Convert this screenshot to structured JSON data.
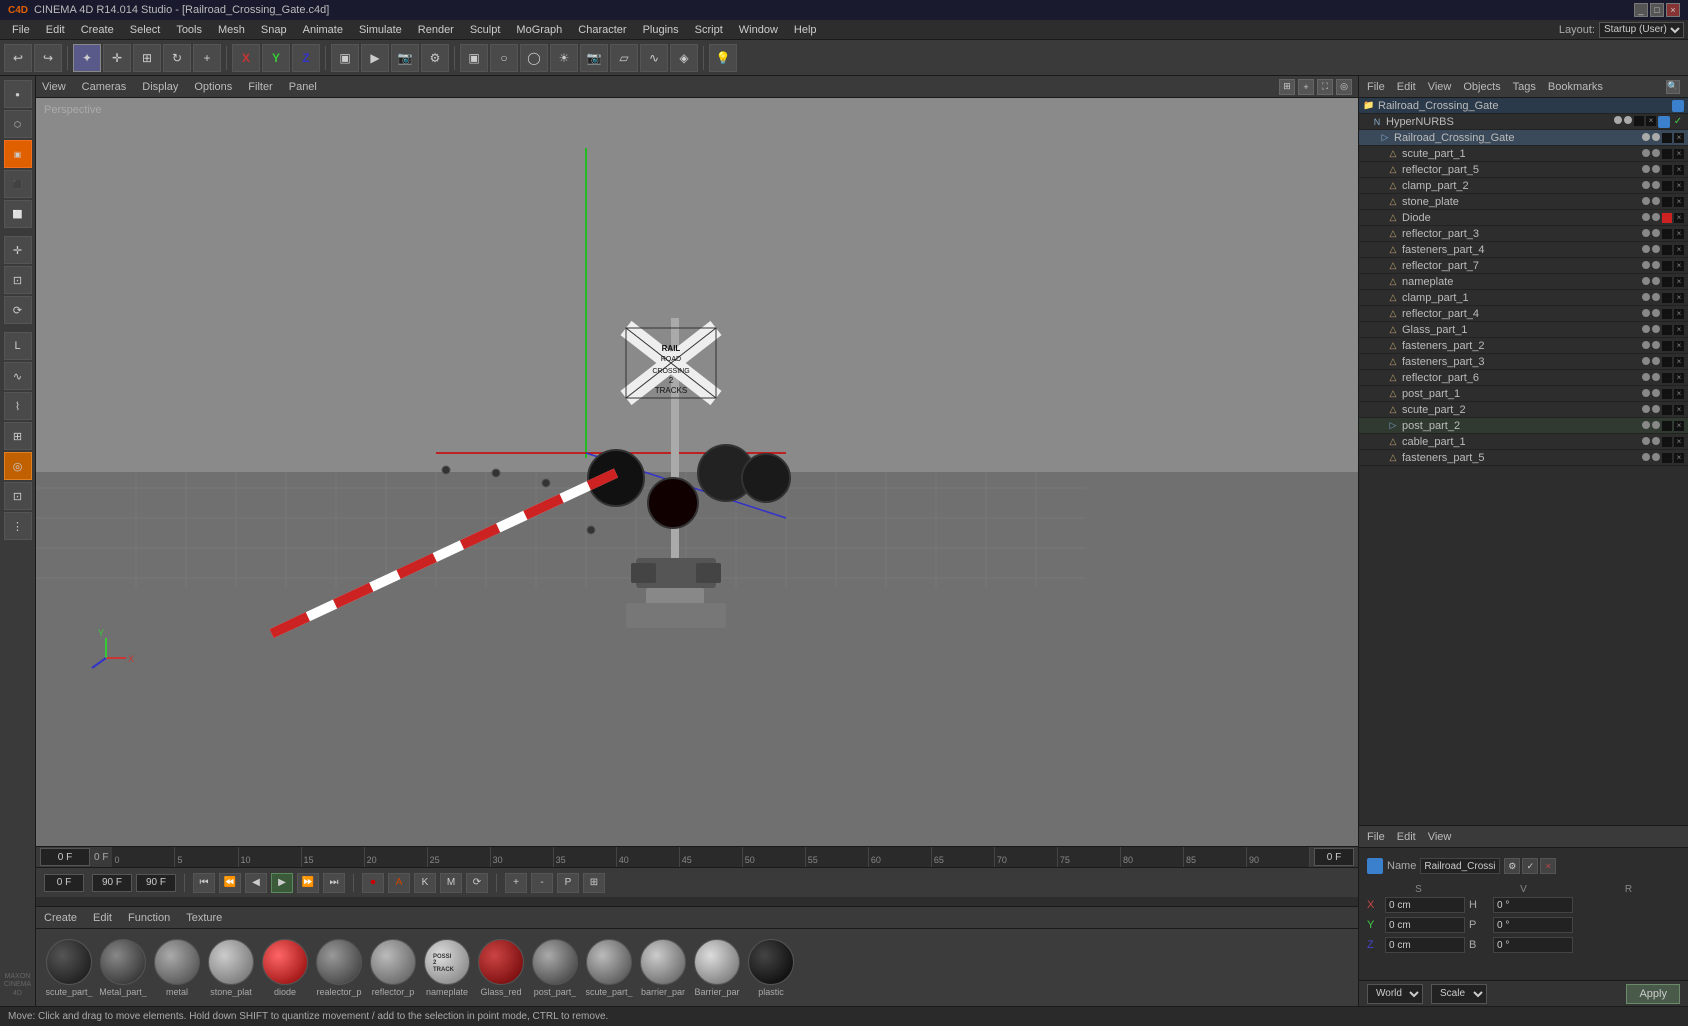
{
  "titleBar": {
    "title": "CINEMA 4D R14.014 Studio - [Railroad_Crossing_Gate.c4d]",
    "winControls": [
      "_",
      "□",
      "×"
    ]
  },
  "menuBar": {
    "items": [
      "File",
      "Edit",
      "Create",
      "Select",
      "Tools",
      "Mesh",
      "Snap",
      "Animate",
      "Simulate",
      "Render",
      "Sculpt",
      "MoGraph",
      "Character",
      "Plugins",
      "Script",
      "Window",
      "Help"
    ]
  },
  "layout": {
    "label": "Layout:",
    "value": "Startup (User)"
  },
  "viewport": {
    "label": "Perspective",
    "tabs": [
      "View",
      "Cameras",
      "Display",
      "Options",
      "Filter",
      "Panel"
    ]
  },
  "objectManager": {
    "tabs": [
      "File",
      "Edit",
      "View",
      "Objects",
      "Tags",
      "Bookmarks"
    ],
    "rootItem": "Railroad_Crossing_Gate",
    "items": [
      {
        "name": "HyperNURBS",
        "level": 1,
        "type": "nurbs",
        "icon": "N"
      },
      {
        "name": "Railroad_Crossing_Gate",
        "level": 2,
        "type": "folder"
      },
      {
        "name": "scute_part_1",
        "level": 3,
        "type": "mesh"
      },
      {
        "name": "reflector_part_5",
        "level": 3,
        "type": "mesh"
      },
      {
        "name": "clamp_part_2",
        "level": 3,
        "type": "mesh"
      },
      {
        "name": "stone_plate",
        "level": 3,
        "type": "mesh"
      },
      {
        "name": "Diode",
        "level": 3,
        "type": "mesh"
      },
      {
        "name": "reflector_part_3",
        "level": 3,
        "type": "mesh"
      },
      {
        "name": "fasteners_part_4",
        "level": 3,
        "type": "mesh"
      },
      {
        "name": "reflector_part_7",
        "level": 3,
        "type": "mesh"
      },
      {
        "name": "nameplate",
        "level": 3,
        "type": "mesh"
      },
      {
        "name": "clamp_part_1",
        "level": 3,
        "type": "mesh"
      },
      {
        "name": "reflector_part_4",
        "level": 3,
        "type": "mesh"
      },
      {
        "name": "Glass_part_1",
        "level": 3,
        "type": "mesh"
      },
      {
        "name": "fasteners_part_2",
        "level": 3,
        "type": "mesh"
      },
      {
        "name": "fasteners_part_3",
        "level": 3,
        "type": "mesh"
      },
      {
        "name": "reflector_part_6",
        "level": 3,
        "type": "mesh"
      },
      {
        "name": "post_part_1",
        "level": 3,
        "type": "mesh"
      },
      {
        "name": "scute_part_2",
        "level": 3,
        "type": "mesh"
      },
      {
        "name": "post_part_2",
        "level": 3,
        "type": "folder"
      },
      {
        "name": "cable_part_1",
        "level": 3,
        "type": "mesh"
      },
      {
        "name": "fasteners_part_5",
        "level": 3,
        "type": "mesh"
      }
    ]
  },
  "attributeManager": {
    "tabs": [
      "File",
      "Edit",
      "View"
    ],
    "nameLabel": "Name",
    "nameValue": "Railroad_Crossing_Gate",
    "coords": {
      "x": {
        "label": "X",
        "pos": "0 cm",
        "size": "H",
        "sizeVal": "0°"
      },
      "y": {
        "label": "Y",
        "pos": "0 cm",
        "size": "P",
        "sizeVal": "0°"
      },
      "z": {
        "label": "Z",
        "pos": "0 cm",
        "size": "B",
        "sizeVal": "0°"
      }
    },
    "coordMode": "World",
    "transformMode": "Scale",
    "applyLabel": "Apply"
  },
  "timeline": {
    "currentFrame": "0 F",
    "startFrame": "0 F",
    "startInput": "0 F",
    "endFrame": "90 F",
    "endInput": "90 F",
    "marks": [
      "0",
      "5",
      "10",
      "15",
      "20",
      "25",
      "30",
      "35",
      "40",
      "45",
      "50",
      "55",
      "60",
      "65",
      "70",
      "75",
      "80",
      "85",
      "90"
    ]
  },
  "materialArea": {
    "tabs": [
      "Create",
      "Edit",
      "Function",
      "Texture"
    ],
    "materials": [
      {
        "label": "scute_part_",
        "color": "#111",
        "gradient": "radial-gradient(circle at 35% 35%, #555, #111)"
      },
      {
        "label": "Metal_part_",
        "color": "#333",
        "gradient": "radial-gradient(circle at 35% 35%, #888, #222)"
      },
      {
        "label": "metal",
        "color": "#555",
        "gradient": "radial-gradient(circle at 35% 35%, #aaa, #444)"
      },
      {
        "label": "stone_plat",
        "color": "#666",
        "gradient": "radial-gradient(circle at 35% 35%, #ccc, #666)"
      },
      {
        "label": "diode",
        "color": "#cc0000",
        "gradient": "radial-gradient(circle at 35% 35%, #ff6666, #880000)"
      },
      {
        "label": "realector_p",
        "color": "#444",
        "gradient": "radial-gradient(circle at 35% 35%, #999, #333)"
      },
      {
        "label": "reflector_p",
        "color": "#666",
        "gradient": "radial-gradient(circle at 35% 35%, #bbb, #555)"
      },
      {
        "label": "nameplate",
        "color": "#888",
        "gradient": "radial-gradient(circle at 35% 35%, #ddd, #777), url()"
      },
      {
        "label": "Glass_red",
        "color": "#880000",
        "gradient": "radial-gradient(circle at 35% 35%, #cc4444, #660000)"
      },
      {
        "label": "post_part_",
        "color": "#555",
        "gradient": "radial-gradient(circle at 35% 35%, #aaa, #333)"
      },
      {
        "label": "scute_part_",
        "color": "#666",
        "gradient": "radial-gradient(circle at 35% 35%, #bbb, #444)"
      },
      {
        "label": "barrier_par",
        "color": "#777",
        "gradient": "radial-gradient(circle at 35% 35%, #ccc, #555)"
      },
      {
        "label": "Barrier_par",
        "color": "#888",
        "gradient": "radial-gradient(circle at 35% 35%, #ddd, #666)"
      },
      {
        "label": "plastic",
        "color": "#111",
        "gradient": "radial-gradient(circle at 35% 35%, #444, #000)"
      }
    ]
  },
  "statusBar": {
    "text": "Move: Click and drag to move elements. Hold down SHIFT to quantize movement / add to the selection in point mode, CTRL to remove."
  }
}
